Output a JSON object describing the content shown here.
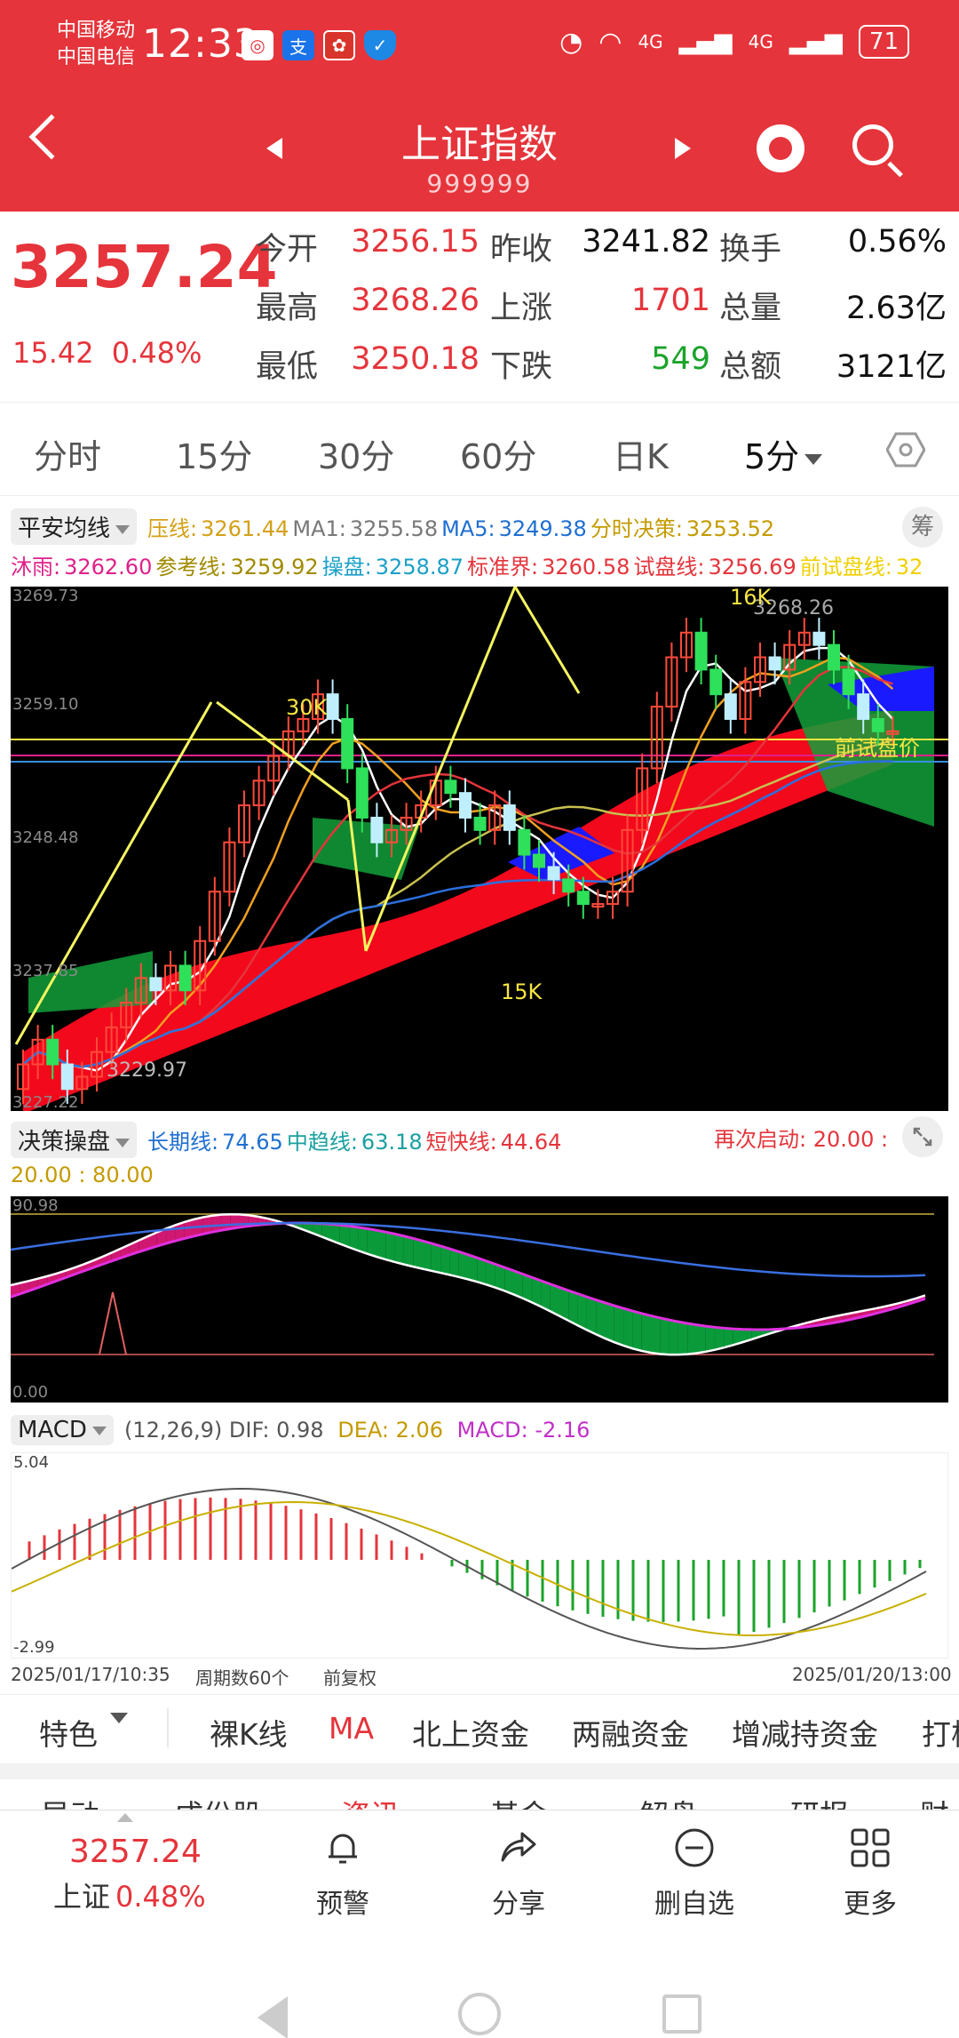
{
  "status": {
    "carrier1": "中国移动",
    "carrier2": "中国电信",
    "time": "12:33",
    "signal1": "4G",
    "signal2": "4G",
    "battery": "71"
  },
  "header": {
    "title": "上证指数",
    "code": "999999"
  },
  "quote": {
    "price": "3257.24",
    "change": "15.42",
    "change_pct": "0.48%",
    "rows": [
      [
        {
          "label": "今开",
          "value": "3256.15",
          "color": "red"
        },
        {
          "label": "昨收",
          "value": "3241.82",
          "color": "blk"
        },
        {
          "label": "换手",
          "value": "0.56%",
          "color": "blk"
        }
      ],
      [
        {
          "label": "最高",
          "value": "3268.26",
          "color": "red"
        },
        {
          "label": "上涨",
          "value": "1701",
          "color": "red"
        },
        {
          "label": "总量",
          "value": "2.63亿",
          "color": "blk"
        }
      ],
      [
        {
          "label": "最低",
          "value": "3250.18",
          "color": "red"
        },
        {
          "label": "下跌",
          "value": "549",
          "color": "green"
        },
        {
          "label": "总额",
          "value": "3121亿",
          "color": "blk"
        }
      ]
    ]
  },
  "period_tabs": [
    "分时",
    "15分",
    "30分",
    "60分",
    "日K",
    "5分"
  ],
  "main_indicator": {
    "selector": "平安均线",
    "chou": "筹",
    "line1": [
      {
        "t": "压线:",
        "v": "3261.44",
        "c": "#d4a017"
      },
      {
        "t": "MA1:",
        "v": "3255.58",
        "c": "#777"
      },
      {
        "t": "MA5:",
        "v": "3249.38",
        "c": "#1f6fd1"
      },
      {
        "t": "分时决策:",
        "v": "3253.52",
        "c": "#c49a00"
      }
    ],
    "line2": [
      {
        "t": "沐雨:",
        "v": "3262.60",
        "c": "#e0208a"
      },
      {
        "t": "参考线:",
        "v": "3259.92",
        "c": "#a08a00"
      },
      {
        "t": "操盘:",
        "v": "3258.87",
        "c": "#1aa0c8"
      },
      {
        "t": "标准界:",
        "v": "3260.58",
        "c": "#e5343b"
      },
      {
        "t": "试盘线:",
        "v": "3256.69",
        "c": "#e5343b"
      },
      {
        "t": "前试盘线:",
        "v": "32",
        "c": "#f0d000"
      }
    ]
  },
  "kchart": {
    "y_labels": [
      "3269.73",
      "3259.10",
      "3248.48",
      "3237.85",
      "3227.22"
    ],
    "high_label": "3268.26",
    "low_label": "3229.97",
    "ann_30k": "30K",
    "ann_16k": "16K",
    "ann_15k": "15K",
    "ann_qian": "前试盘价"
  },
  "decision": {
    "selector": "决策操盘",
    "items": [
      {
        "t": "长期线:",
        "v": "74.65",
        "c": "#1f6fd1"
      },
      {
        "t": "中趋线:",
        "v": "63.18",
        "c": "#1aa0a0"
      },
      {
        "t": "短快线:",
        "v": "44.64",
        "c": "#e5343b"
      }
    ],
    "restart": "再次启动: 20.00 :",
    "line2": "20.00 : 80.00",
    "top_label": "90.98",
    "bottom_label": "0.00"
  },
  "macd": {
    "selector": "MACD",
    "params": "(12,26,9)",
    "dif": "DIF: 0.98",
    "dea": "DEA: 2.06",
    "macd": "MACD: -2.16",
    "top_label": "5.04",
    "bottom_label": "-2.99"
  },
  "info": {
    "start": "2025/01/17/10:35",
    "periods": "周期数60个",
    "fuquan": "前复权",
    "end": "2025/01/20/13:00"
  },
  "feature_tabs": [
    "特色",
    "裸K线",
    "MA",
    "北上资金",
    "两融资金",
    "增减持资金",
    "打板"
  ],
  "news_tabs": [
    "异动",
    "成份股",
    "资讯",
    "基金",
    "解盘",
    "研报",
    "财务"
  ],
  "bottom": {
    "price": "3257.24",
    "name": "上证",
    "pct": "0.48%",
    "items": [
      "预警",
      "分享",
      "删自选",
      "更多"
    ]
  }
}
